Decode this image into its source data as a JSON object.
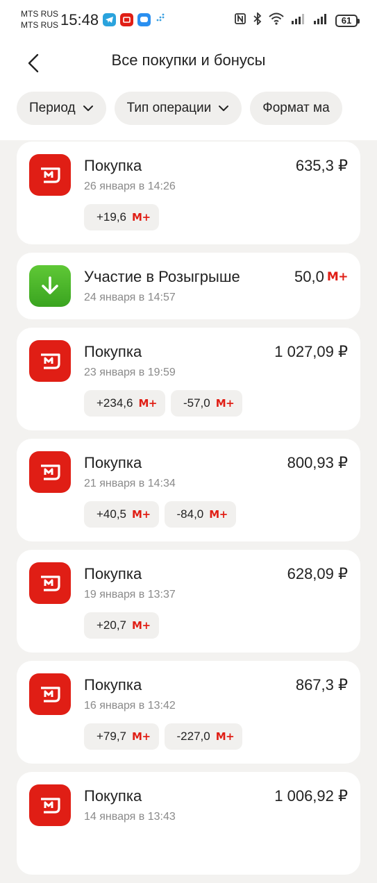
{
  "status_bar": {
    "carrier1": "MTS RUS",
    "carrier2": "MTS RUS",
    "time": "15:48",
    "battery": "61"
  },
  "header": {
    "title": "Все покупки и бонусы"
  },
  "filters": [
    {
      "label": "Период"
    },
    {
      "label": "Тип операции"
    },
    {
      "label": "Формат ма"
    }
  ],
  "bonus_currency": "М+",
  "transactions": [
    {
      "title": "Покупка",
      "date": "26 января в 14:26",
      "amount": "635,3 ₽",
      "icon": "magnit-logo-icon",
      "bonuses": [
        "+19,6"
      ]
    },
    {
      "title": "Участие в Розыгрыше",
      "date": "24 января в 14:57",
      "amount": "50,0",
      "amount_suffix": "М+",
      "icon": "download-arrow-icon",
      "bonuses": []
    },
    {
      "title": "Покупка",
      "date": "23 января в 19:59",
      "amount": "1 027,09 ₽",
      "icon": "magnit-logo-icon",
      "bonuses": [
        "+234,6",
        "-57,0"
      ]
    },
    {
      "title": "Покупка",
      "date": "21 января в 14:34",
      "amount": "800,93 ₽",
      "icon": "magnit-logo-icon",
      "bonuses": [
        "+40,5",
        "-84,0"
      ]
    },
    {
      "title": "Покупка",
      "date": "19 января в 13:37",
      "amount": "628,09 ₽",
      "icon": "magnit-logo-icon",
      "bonuses": [
        "+20,7"
      ]
    },
    {
      "title": "Покупка",
      "date": "16 января в 13:42",
      "amount": "867,3 ₽",
      "icon": "magnit-logo-icon",
      "bonuses": [
        "+79,7",
        "-227,0"
      ]
    },
    {
      "title": "Покупка",
      "date": "14 января в 13:43",
      "amount": "1 006,92 ₽",
      "icon": "magnit-logo-icon",
      "bonuses": []
    }
  ]
}
